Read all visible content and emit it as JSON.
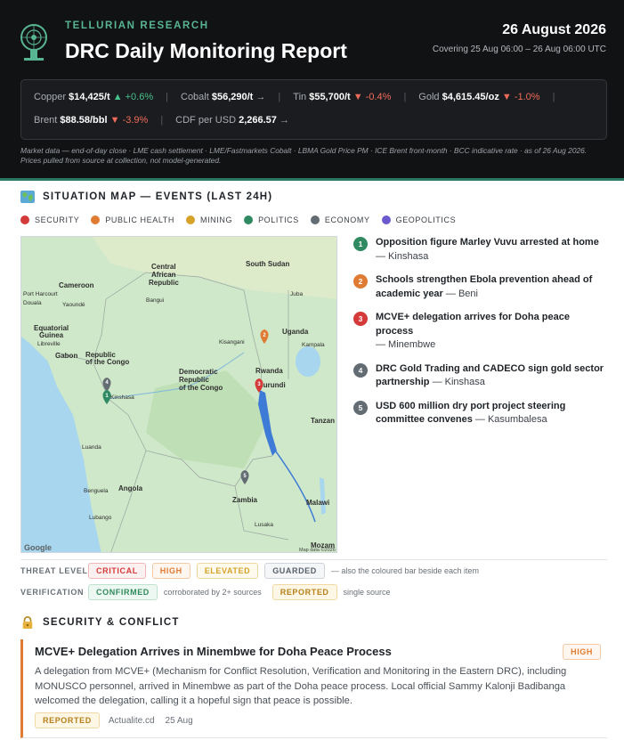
{
  "header": {
    "brand": "TELLURIAN RESEARCH",
    "title": "DRC Daily Monitoring Report",
    "date": "26 August 2026",
    "covering": "Covering 25 Aug 06:00 – 26 Aug 06:00 UTC",
    "logo_icon": "tellurian-logo-icon"
  },
  "market": {
    "items": [
      {
        "label": "Copper",
        "value": "$14,425/t",
        "change": "▲ +0.6%",
        "direction": "up"
      },
      {
        "label": "Cobalt",
        "value": "$56,290/t",
        "change": "→",
        "direction": "flat"
      },
      {
        "label": "Tin",
        "value": "$55,700/t",
        "change": "▼ -0.4%",
        "direction": "down"
      },
      {
        "label": "Gold",
        "value": "$4,615.45/oz",
        "change": "▼ -1.0%",
        "direction": "down"
      },
      {
        "label": "Brent",
        "value": "$88.58/bbl",
        "change": "▼ -3.9%",
        "direction": "down"
      },
      {
        "label": "CDF per USD",
        "value": "2,266.57",
        "change": "→",
        "direction": "flat"
      }
    ],
    "note": "Market data — end-of-day close · LME cash settlement · LME/Fastmarkets Cobalt · LBMA Gold Price PM · ICE Brent front-month · BCC indicative rate · as of 26 Aug 2026. Prices pulled from source at collection, not model-generated."
  },
  "map_section": {
    "title": "SITUATION MAP — EVENTS (LAST 24H)",
    "icon": "world-map-icon",
    "legend": [
      {
        "label": "SECURITY",
        "color": "#d43a3a"
      },
      {
        "label": "PUBLIC HEALTH",
        "color": "#e07b33"
      },
      {
        "label": "MINING",
        "color": "#d6a228"
      },
      {
        "label": "POLITICS",
        "color": "#2f8a62"
      },
      {
        "label": "ECONOMY",
        "color": "#636b73"
      },
      {
        "label": "GEOPOLITICS",
        "color": "#6a5acd"
      }
    ],
    "map_labels": {
      "south_sudan": "South Sudan",
      "car_1": "Central",
      "car_2": "African",
      "car_3": "Republic",
      "cameroon": "Cameroon",
      "eq_guinea_1": "Equatorial",
      "eq_guinea_2": "Guinea",
      "gabon": "Gabon",
      "roc_1": "Republic",
      "roc_2": "of the Congo",
      "drc_1": "Democratic",
      "drc_2": "Republic",
      "drc_3": "of the Congo",
      "uganda": "Uganda",
      "rwanda": "Rwanda",
      "burundi": "Burundi",
      "tanzania": "Tanzan",
      "angola": "Angola",
      "zambia": "Zambia",
      "malawi": "Malawi",
      "mozam": "Mozam",
      "port_harcourt": "Port Harcourt",
      "douala": "Douala",
      "yaounde": "Yaoundé",
      "bangui": "Bangui",
      "juba": "Juba",
      "libreville": "Libreville",
      "kisangani": "Kisangani",
      "kampala": "Kampala",
      "kinshasa": "Kinshasa",
      "luanda": "Luanda",
      "benguela": "Benguela",
      "lubango": "Lubango",
      "lusaka": "Lusaka",
      "google": "Google",
      "attribution": "Map data ©2026"
    },
    "events": [
      {
        "num": "1",
        "color": "#2f8a62",
        "title": "Opposition figure Marley Vuvu arrested at home",
        "place": "— Kinshasa"
      },
      {
        "num": "2",
        "color": "#e07b33",
        "title": "Schools strengthen Ebola prevention ahead of academic year",
        "place": "— Beni"
      },
      {
        "num": "3",
        "color": "#d43a3a",
        "title": "MCVE+ delegation arrives for Doha peace process",
        "place": "— Minembwe"
      },
      {
        "num": "4",
        "color": "#636b73",
        "title": "DRC Gold Trading and CADECO sign gold sector partnership",
        "place": "— Kinshasa"
      },
      {
        "num": "5",
        "color": "#636b73",
        "title": "USD 600 million dry port project steering committee convenes",
        "place": "— Kasumbalesa"
      }
    ]
  },
  "key": {
    "threat_label": "THREAT LEVEL",
    "threat_levels": [
      "CRITICAL",
      "HIGH",
      "ELEVATED",
      "GUARDED"
    ],
    "threat_note": "— also the coloured bar beside each item",
    "verification_label": "VERIFICATION",
    "confirmed": "CONFIRMED",
    "confirmed_note": "corroborated by 2+ sources",
    "reported": "REPORTED",
    "reported_note": "single source"
  },
  "security": {
    "title": "SECURITY & CONFLICT",
    "icon": "lock-icon",
    "card": {
      "title": "MCVE+ Delegation Arrives in Minembwe for Doha Peace Process",
      "threat": "HIGH",
      "body": "A delegation from MCVE+ (Mechanism for Conflict Resolution, Verification and Monitoring in the Eastern DRC), including MONUSCO personnel, arrived in Minembwe as part of the Doha peace process. Local official Sammy Kalonji Badibanga welcomed the delegation, calling it a hopeful sign that peace is possible.",
      "verification": "REPORTED",
      "source": "Actualite.cd",
      "date": "25 Aug"
    }
  }
}
